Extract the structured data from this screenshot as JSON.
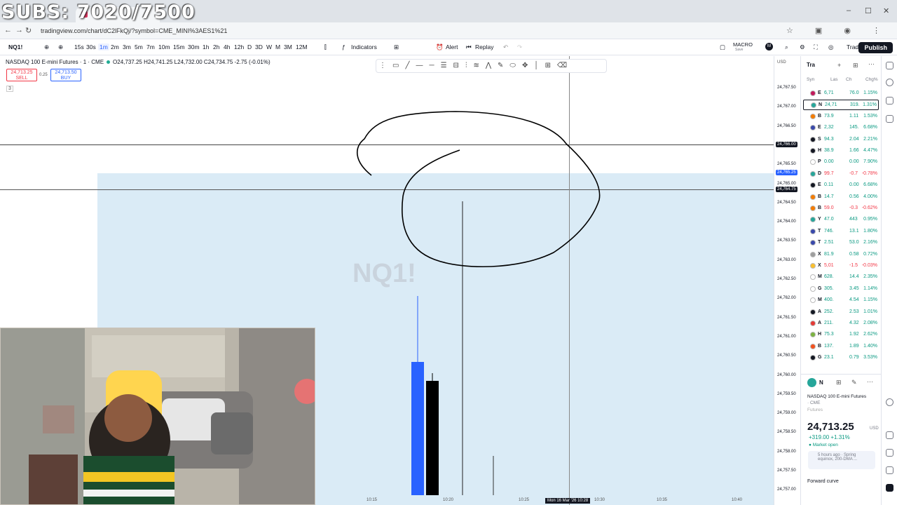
{
  "overlay": {
    "subs_text": "SUBS: 7020/7500"
  },
  "browser": {
    "url": "tradingview.com/chart/dC2lFkQj/?symbol=CME_MINI%3AES1%21",
    "window_controls": [
      "–",
      "☐",
      "✕"
    ]
  },
  "toolbar": {
    "symbol": "NQ1!",
    "intervals": [
      "15s",
      "30s",
      "1m",
      "2m",
      "3m",
      "5m",
      "7m",
      "10m",
      "15m",
      "30m",
      "1h",
      "2h",
      "4h",
      "12h",
      "D",
      "3D",
      "W",
      "M",
      "3M",
      "12M"
    ],
    "selected_interval": "1m",
    "indicators_label": "Indicators",
    "alert_label": "Alert",
    "replay_label": "Replay",
    "layout_name": "MACRO",
    "layout_sub": "Save",
    "avatar_letter": "M",
    "trade_label": "Trade",
    "publish_label": "Publish"
  },
  "chart": {
    "title": "NASDAQ 100 E-mini Futures · 1 · CME",
    "ohlc": "O24,737.25 H24,741.25 L24,732.00 C24,734.75 -2.75 (-0.01%)",
    "sell_price": "24,713.25",
    "sell_label": "SELL",
    "spread": "0.25",
    "buy_price": "24,713.50",
    "buy_label": "BUY",
    "indicator_count": "3",
    "watermark": "NQ1!",
    "currency": "USD",
    "price_labels": [
      "24,767.50",
      "24,767.00",
      "24,766.50",
      "24,766.00",
      "24,765.50",
      "24,765.00",
      "24,764.50",
      "24,764.00",
      "24,763.50",
      "24,763.00",
      "24,762.50",
      "24,762.00",
      "24,761.50",
      "24,761.00",
      "24,760.50",
      "24,760.00",
      "24,759.50",
      "24,759.00",
      "24,758.50",
      "24,758.00",
      "24,757.50",
      "24,757.00"
    ],
    "cursor_price": "24,766.00",
    "tag_price_blue": "24,765.25",
    "tag_price_dark": "24,764.75",
    "time_labels": [
      "10:15",
      "10:20",
      "10:25",
      "10:30",
      "10:35",
      "10:40"
    ],
    "cursor_time": "Mon 16 Mar '26  10:28",
    "colors": {
      "up_candle": "#2962ff",
      "down_candle": "#000000",
      "rectangle_fill": "#d8eaf6"
    }
  },
  "watchlist": {
    "title": "Tra",
    "columns": [
      "Syn",
      "Las",
      "Ch",
      "Chg%"
    ],
    "rows": [
      {
        "icon_color": "#c2185b",
        "sym": "E",
        "last": "6,71",
        "chg": "76.0",
        "pct": "1.15%",
        "dir": "up"
      },
      {
        "icon_color": "#26a69a",
        "sym": "N",
        "last": "24,71",
        "chg": "319.",
        "pct": "1.31%",
        "dir": "up",
        "active": true
      },
      {
        "icon_color": "#f57c00",
        "sym": "B",
        "last": "73.9",
        "chg": "1.11",
        "pct": "1.53%",
        "dir": "up"
      },
      {
        "icon_color": "#3949ab",
        "sym": "E",
        "last": "2,32",
        "chg": "145.",
        "pct": "6.68%",
        "dir": "up"
      },
      {
        "icon_color": "#131722",
        "sym": "S",
        "last": "94.3",
        "chg": "2.04",
        "pct": "2.21%",
        "dir": "up"
      },
      {
        "icon_color": "#131722",
        "sym": "H",
        "last": "38.9",
        "chg": "1.66",
        "pct": "4.47%",
        "dir": "up"
      },
      {
        "icon_color": "#ffffff",
        "sym": "P",
        "last": "0.00",
        "chg": "0.00",
        "pct": "7.90%",
        "dir": "up"
      },
      {
        "icon_color": "#26a69a",
        "sym": "D",
        "last": "99.7",
        "chg": "-0.7",
        "pct": "-0.78%",
        "dir": "dn"
      },
      {
        "icon_color": "#131722",
        "sym": "E",
        "last": "0.11",
        "chg": "0.00",
        "pct": "6.68%",
        "dir": "up"
      },
      {
        "icon_color": "#f57c00",
        "sym": "B",
        "last": "14.7",
        "chg": "0.56",
        "pct": "4.00%",
        "dir": "up"
      },
      {
        "icon_color": "#f57c00",
        "sym": "B",
        "last": "59.0",
        "chg": "-0.3",
        "pct": "-0.62%",
        "dir": "dn"
      },
      {
        "icon_color": "#26a69a",
        "sym": "Y",
        "last": "47.0",
        "chg": "443",
        "pct": "0.95%",
        "dir": "up"
      },
      {
        "icon_color": "#3949ab",
        "sym": "T",
        "last": "746.",
        "chg": "13.1",
        "pct": "1.80%",
        "dir": "up"
      },
      {
        "icon_color": "#3949ab",
        "sym": "T",
        "last": "2.51",
        "chg": "53.0",
        "pct": "2.16%",
        "dir": "up"
      },
      {
        "icon_color": "#9e9e9e",
        "sym": "X",
        "last": "81.9",
        "chg": "0.58",
        "pct": "0.72%",
        "dir": "up"
      },
      {
        "icon_color": "#fbc02d",
        "sym": "X",
        "last": "5,01",
        "chg": "-1.5",
        "pct": "-0.03%",
        "dir": "dn"
      },
      {
        "icon_color": "#ffffff",
        "sym": "M",
        "last": "628.",
        "chg": "14.4",
        "pct": "2.35%",
        "dir": "up"
      },
      {
        "icon_color": "#ffffff",
        "sym": "G",
        "last": "305.",
        "chg": "3.45",
        "pct": "1.14%",
        "dir": "up"
      },
      {
        "icon_color": "#ffffff",
        "sym": "M",
        "last": "400.",
        "chg": "4.54",
        "pct": "1.15%",
        "dir": "up"
      },
      {
        "icon_color": "#131722",
        "sym": "A",
        "last": "252.",
        "chg": "2.53",
        "pct": "1.01%",
        "dir": "up"
      },
      {
        "icon_color": "#e53935",
        "sym": "A",
        "last": "211.",
        "chg": "4.32",
        "pct": "2.08%",
        "dir": "up"
      },
      {
        "icon_color": "#7cb342",
        "sym": "H",
        "last": "75.3",
        "chg": "1.92",
        "pct": "2.62%",
        "dir": "up"
      },
      {
        "icon_color": "#f4511e",
        "sym": "B",
        "last": "137.",
        "chg": "1.89",
        "pct": "1.40%",
        "dir": "up"
      },
      {
        "icon_color": "#131722",
        "sym": "G",
        "last": "23.1",
        "chg": "0.79",
        "pct": "3.53%",
        "dir": "up"
      }
    ],
    "detail": {
      "short": "N",
      "name": "NASDAQ 100 E-mini Futures",
      "exchange": "· CME",
      "type": "Futures",
      "price": "24,713.25",
      "currency": "USD",
      "change": "+319.00 +1.31%",
      "status": "● Market open",
      "news": "5 hours ago · Spring equinox, 200-DMA ...",
      "forward": "Forward curve"
    }
  }
}
